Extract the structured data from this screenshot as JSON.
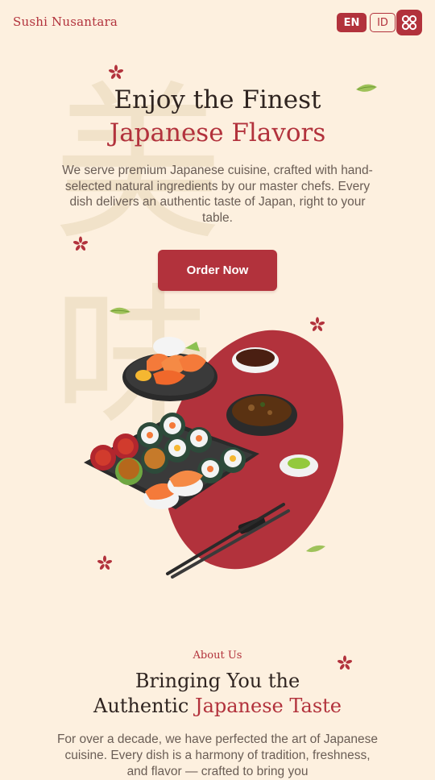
{
  "header": {
    "brand": "Sushi Nusantara",
    "lang_en": "EN",
    "lang_id": "ID",
    "menu_icon": "grid-menu-icon"
  },
  "background": {
    "kanji_1": "美",
    "kanji_2": "味"
  },
  "hero": {
    "title_line1": "Enjoy the Finest",
    "title_line2": "Japanese Flavors",
    "description": "We serve premium Japanese cuisine, crafted with hand-selected natural ingredients by our master chefs. Every dish delivers an authentic taste of Japan, right to your table.",
    "cta_label": "Order Now"
  },
  "about": {
    "label": "About Us",
    "title_line1": "Bringing You the",
    "title_line2_prefix": "Authentic ",
    "title_line2_accent": "Japanese Taste",
    "description": "For over a decade, we have perfected the art of Japanese cuisine. Every dish is a harmony of tradition, freshness, and flavor — crafted to bring you"
  },
  "colors": {
    "background": "#fdf0df",
    "brand_red": "#b2323c",
    "kanji_tint": "#f1e2c9",
    "text_dark": "#2f2420",
    "text_muted": "#6a5d55"
  }
}
